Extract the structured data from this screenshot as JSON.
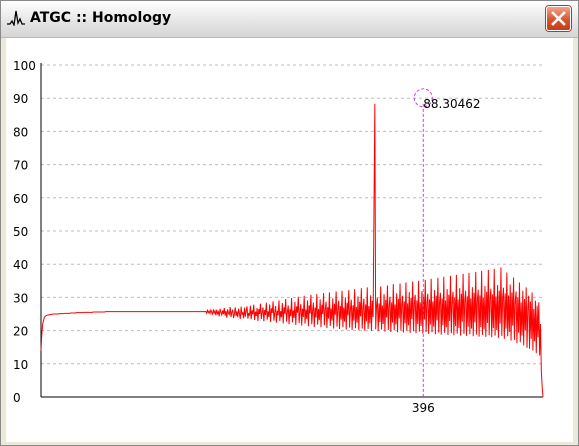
{
  "window": {
    "title": "ATGC :: Homology"
  },
  "chart_data": {
    "type": "line",
    "title": "",
    "xlabel": "",
    "ylabel": "",
    "ylim": [
      0,
      100
    ],
    "xlim": [
      0,
      520
    ],
    "y_ticks": [
      "0",
      "10",
      "20",
      "30",
      "40",
      "50",
      "60",
      "70",
      "80",
      "90",
      "100"
    ],
    "grid": true,
    "legend": "none",
    "series_color": "#ff0000",
    "peak_marker_color": "#cc44cc",
    "peak": {
      "x": 396,
      "y": 88.30462,
      "value_label": "88.30462",
      "x_label": "396"
    },
    "series": [
      {
        "values": [
          14,
          19,
          22,
          23,
          24,
          24.3,
          24.5,
          24.6,
          24.7,
          24.7,
          24.8,
          24.8,
          24.9,
          24.9,
          25,
          25,
          25,
          25,
          25,
          25,
          25,
          25,
          25.1,
          25.1,
          25.1,
          25.1,
          25.1,
          25.1,
          25.2,
          25.2,
          25.2,
          25.2,
          25.2,
          25.2,
          25.2,
          25.3,
          25.3,
          25.3,
          25.3,
          25.3,
          25.3,
          25.3,
          25.4,
          25.4,
          25.4,
          25.4,
          25.4,
          25.4,
          25.4,
          25.4,
          25.4,
          25.5,
          25.5,
          25.5,
          25.5,
          25.5,
          25.5,
          25.5,
          25.5,
          25.5,
          25.5,
          25.5,
          25.6,
          25.6,
          25.6,
          25.6,
          25.6,
          25.6,
          25.6,
          25.6,
          25.6,
          25.6,
          25.6,
          25.6,
          25.6,
          25.6,
          25.6,
          25.7,
          25.7,
          25.7,
          25.7,
          25.7,
          25.7,
          25.7,
          25.7,
          25.7,
          25.7,
          25.7,
          25.7,
          25.7,
          25.7,
          25.7,
          25.7,
          25.7,
          25.7,
          25.7,
          25.7,
          25.7,
          25.7,
          25.7,
          25.7,
          25.7,
          25.7,
          25.7,
          25.7,
          25.7,
          25.7,
          25.7,
          25.7,
          25.7,
          25.7,
          25.7,
          25.7,
          25.7,
          25.7,
          25.7,
          25.7,
          25.7,
          25.7,
          25.7,
          25.7,
          25.7,
          25.7,
          25.7,
          25.7,
          25.7,
          25.7,
          25.7,
          25.7,
          25.7,
          25.7,
          25.7,
          25.7,
          25.7,
          25.7,
          25.7,
          25.7,
          25.7,
          25.7,
          25.7,
          25.7,
          25.7,
          25.7,
          25.7,
          25.7,
          25.7,
          25.7,
          25.7,
          25.7,
          25.7,
          25.7,
          25.7,
          25.7,
          25.7,
          25.7,
          25.7,
          25.7,
          25.7,
          25.7,
          25.7,
          25.7,
          25.7,
          25.7,
          25.7,
          25.7,
          25.7,
          25.7,
          25.7,
          25.7,
          25.7,
          25.7,
          25.7,
          25.7,
          25.7,
          25.7,
          25.7,
          25.7,
          25.7,
          25.7,
          25.7,
          25.7,
          25.7,
          25.7,
          25.7,
          25.7,
          25.7,
          25.7,
          25.7,
          25.7,
          25.7,
          25.7,
          25.7,
          25.7,
          25.7,
          25.7,
          25.7,
          25.8,
          25.2,
          26.1,
          25.4,
          25.9,
          25.1,
          26.2,
          25.5,
          24.8,
          26.4,
          25.3,
          25.9,
          24.6,
          26.3,
          25.1,
          25.7,
          24.3,
          26.6,
          25.4,
          24.7,
          26.1,
          25.0,
          26.8,
          24.5,
          25.9,
          23.9,
          26.4,
          25.2,
          24.8,
          27.1,
          24.1,
          25.6,
          26.3,
          23.8,
          25.0,
          27.0,
          24.4,
          25.8,
          24.0,
          26.6,
          25.1,
          23.5,
          27.2,
          24.8,
          25.5,
          23.7,
          26.9,
          24.2,
          25.9,
          27.3,
          23.6,
          25.3,
          24.5,
          27.5,
          23.4,
          26.1,
          24.9,
          27.8,
          23.2,
          25.7,
          24.4,
          26.8,
          22.9,
          26.5,
          25.0,
          28.1,
          23.5,
          25.4,
          27.0,
          22.8,
          26.2,
          24.7,
          28.4,
          23.3,
          25.8,
          24.1,
          27.9,
          22.6,
          26.7,
          25.3,
          28.8,
          23.0,
          25.5,
          27.4,
          22.4,
          26.0,
          24.6,
          29.1,
          22.9,
          25.9,
          24.0,
          28.3,
          22.2,
          27.0,
          25.1,
          29.5,
          22.7,
          25.6,
          27.6,
          21.9,
          26.4,
          24.3,
          29.8,
          22.5,
          26.1,
          23.8,
          28.7,
          21.7,
          27.3,
          25.4,
          30.2,
          22.3,
          25.8,
          28.0,
          21.5,
          26.6,
          24.1,
          30.5,
          22.1,
          26.3,
          23.5,
          29.1,
          21.3,
          27.6,
          25.2,
          30.8,
          21.9,
          26.0,
          28.4,
          21.1,
          26.9,
          23.9,
          31.0,
          21.8,
          26.5,
          23.2,
          29.4,
          21.0,
          27.8,
          25.0,
          31.3,
          21.6,
          26.2,
          28.7,
          20.8,
          27.1,
          23.6,
          31.5,
          21.4,
          26.7,
          23.0,
          29.7,
          20.6,
          28.1,
          24.8,
          31.8,
          21.2,
          26.4,
          29.0,
          20.5,
          27.4,
          23.3,
          32.0,
          21.0,
          26.9,
          22.7,
          30.0,
          20.3,
          28.4,
          24.6,
          32.2,
          20.9,
          26.6,
          29.3,
          20.2,
          27.6,
          23.0,
          32.5,
          20.7,
          27.1,
          22.4,
          30.3,
          20.1,
          28.7,
          24.3,
          32.8,
          20.6,
          26.9,
          29.6,
          20.0,
          27.9,
          22.8,
          33.0,
          20.5,
          27.4,
          22.2,
          30.6,
          19.9,
          29.0,
          24.1,
          57.0,
          88.30462,
          20.4,
          27.2,
          29.9,
          19.8,
          28.2,
          22.6,
          33.3,
          20.3,
          27.6,
          22.0,
          31.0,
          19.7,
          29.3,
          23.9,
          33.6,
          20.2,
          27.5,
          30.2,
          19.6,
          28.5,
          22.4,
          34.0,
          20.1,
          27.9,
          21.8,
          31.3,
          19.5,
          29.6,
          23.7,
          34.2,
          20.0,
          27.7,
          30.5,
          19.4,
          28.8,
          22.2,
          34.5,
          19.9,
          28.2,
          21.6,
          31.6,
          19.3,
          29.9,
          23.5,
          34.8,
          19.8,
          28.0,
          30.8,
          19.2,
          29.1,
          22.0,
          35.0,
          19.7,
          28.5,
          21.4,
          31.9,
          19.1,
          30.2,
          23.3,
          35.3,
          19.6,
          28.3,
          31.1,
          19.0,
          29.4,
          21.8,
          35.6,
          19.5,
          28.8,
          21.2,
          32.2,
          18.9,
          30.5,
          23.1,
          35.9,
          19.4,
          28.6,
          31.4,
          18.8,
          29.7,
          21.6,
          36.2,
          19.3,
          29.1,
          21.0,
          32.5,
          18.7,
          30.8,
          22.9,
          36.5,
          19.2,
          28.9,
          31.7,
          18.6,
          30.0,
          21.4,
          36.8,
          19.1,
          29.4,
          20.8,
          32.8,
          18.5,
          31.1,
          22.7,
          37.1,
          19.0,
          29.2,
          32.0,
          18.4,
          30.3,
          21.2,
          37.4,
          18.9,
          29.7,
          20.6,
          33.1,
          18.3,
          31.4,
          22.5,
          37.7,
          18.8,
          29.5,
          32.3,
          18.2,
          30.6,
          21.0,
          38.0,
          18.7,
          30.0,
          20.4,
          33.4,
          18.1,
          31.7,
          22.3,
          38.3,
          18.6,
          29.8,
          32.6,
          18.0,
          30.9,
          20.8,
          38.6,
          18.5,
          30.3,
          20.2,
          33.7,
          17.8,
          32.0,
          22.1,
          39.0,
          18.4,
          30.1,
          32.9,
          17.5,
          31.2,
          20.6,
          37.5,
          18.3,
          30.6,
          19.6,
          33.9,
          17.0,
          31.5,
          21.5,
          36.0,
          17.2,
          29.0,
          31.8,
          16.2,
          30.0,
          19.4,
          34.5,
          16.5,
          28.5,
          18.5,
          32.0,
          15.5,
          29.5,
          20.0,
          33.0,
          14.8,
          27.0,
          30.5,
          14.5,
          28.8,
          17.5,
          31.5,
          14.0,
          26.5,
          16.8,
          29.0,
          13.2,
          27.5,
          18.0,
          28.5,
          12.5,
          22.0,
          8.0,
          3.0,
          0
        ]
      }
    ]
  }
}
